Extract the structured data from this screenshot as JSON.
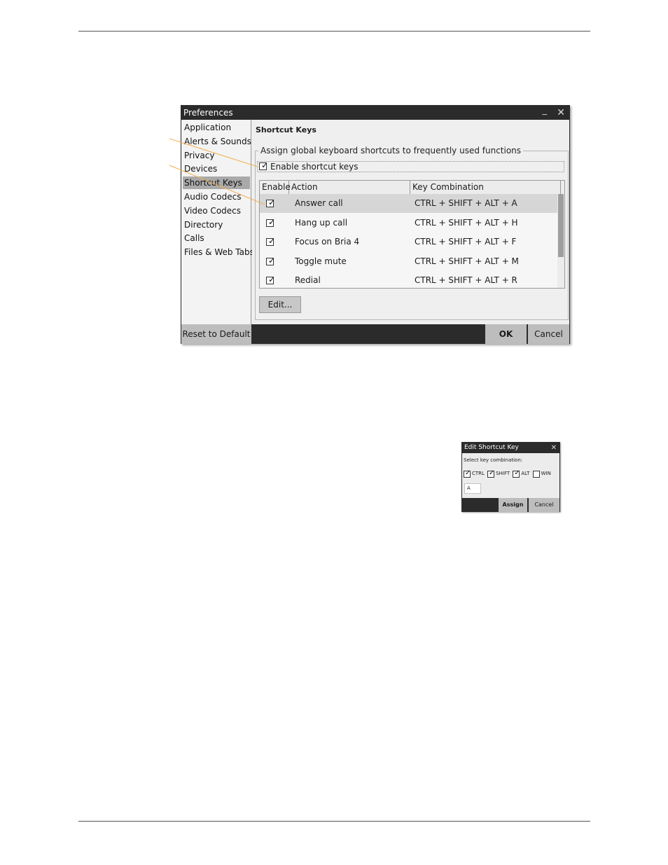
{
  "preferences": {
    "title": "Preferences",
    "minimize_glyph": "_",
    "close_glyph": "✕",
    "sidebar": {
      "items": [
        {
          "label": "Application"
        },
        {
          "label": "Alerts & Sounds"
        },
        {
          "label": "Privacy"
        },
        {
          "label": "Devices"
        },
        {
          "label": "Shortcut Keys",
          "active": true
        },
        {
          "label": "Audio Codecs"
        },
        {
          "label": "Video Codecs"
        },
        {
          "label": "Directory"
        },
        {
          "label": "Calls"
        },
        {
          "label": "Files & Web Tabs"
        }
      ]
    },
    "section_title": "Shortcut Keys",
    "group_label": "Assign global keyboard shortcuts to frequently used functions",
    "enable_shortcut_keys": {
      "label": "Enable shortcut keys",
      "checked": true
    },
    "table": {
      "columns": [
        "Enable",
        "Action",
        "Key Combination"
      ],
      "rows": [
        {
          "enabled": true,
          "action": "Answer call",
          "key": "CTRL + SHIFT + ALT + A",
          "selected": true
        },
        {
          "enabled": true,
          "action": "Hang up call",
          "key": "CTRL + SHIFT + ALT + H"
        },
        {
          "enabled": true,
          "action": "Focus on Bria 4",
          "key": "CTRL + SHIFT + ALT + F"
        },
        {
          "enabled": true,
          "action": "Toggle mute",
          "key": "CTRL + SHIFT + ALT + M"
        },
        {
          "enabled": true,
          "action": "Redial",
          "key": "CTRL + SHIFT + ALT + R"
        }
      ]
    },
    "edit_button": "Edit...",
    "reset_button": "Reset to Default",
    "ok_button": "OK",
    "cancel_button": "Cancel"
  },
  "edit_dialog": {
    "title": "Edit Shortcut Key",
    "close_glyph": "✕",
    "prompt": "Select key combination:",
    "modifiers": [
      {
        "label": "CTRL",
        "checked": true
      },
      {
        "label": "SHIFT",
        "checked": true
      },
      {
        "label": "ALT",
        "checked": true
      },
      {
        "label": "WIN",
        "checked": false
      }
    ],
    "key_value": "A",
    "assign_button": "Assign",
    "cancel_button": "Cancel"
  },
  "colors": {
    "callout": "#f0b050",
    "titlebar": "#2b2b2b",
    "button": "#bdbdbd"
  }
}
